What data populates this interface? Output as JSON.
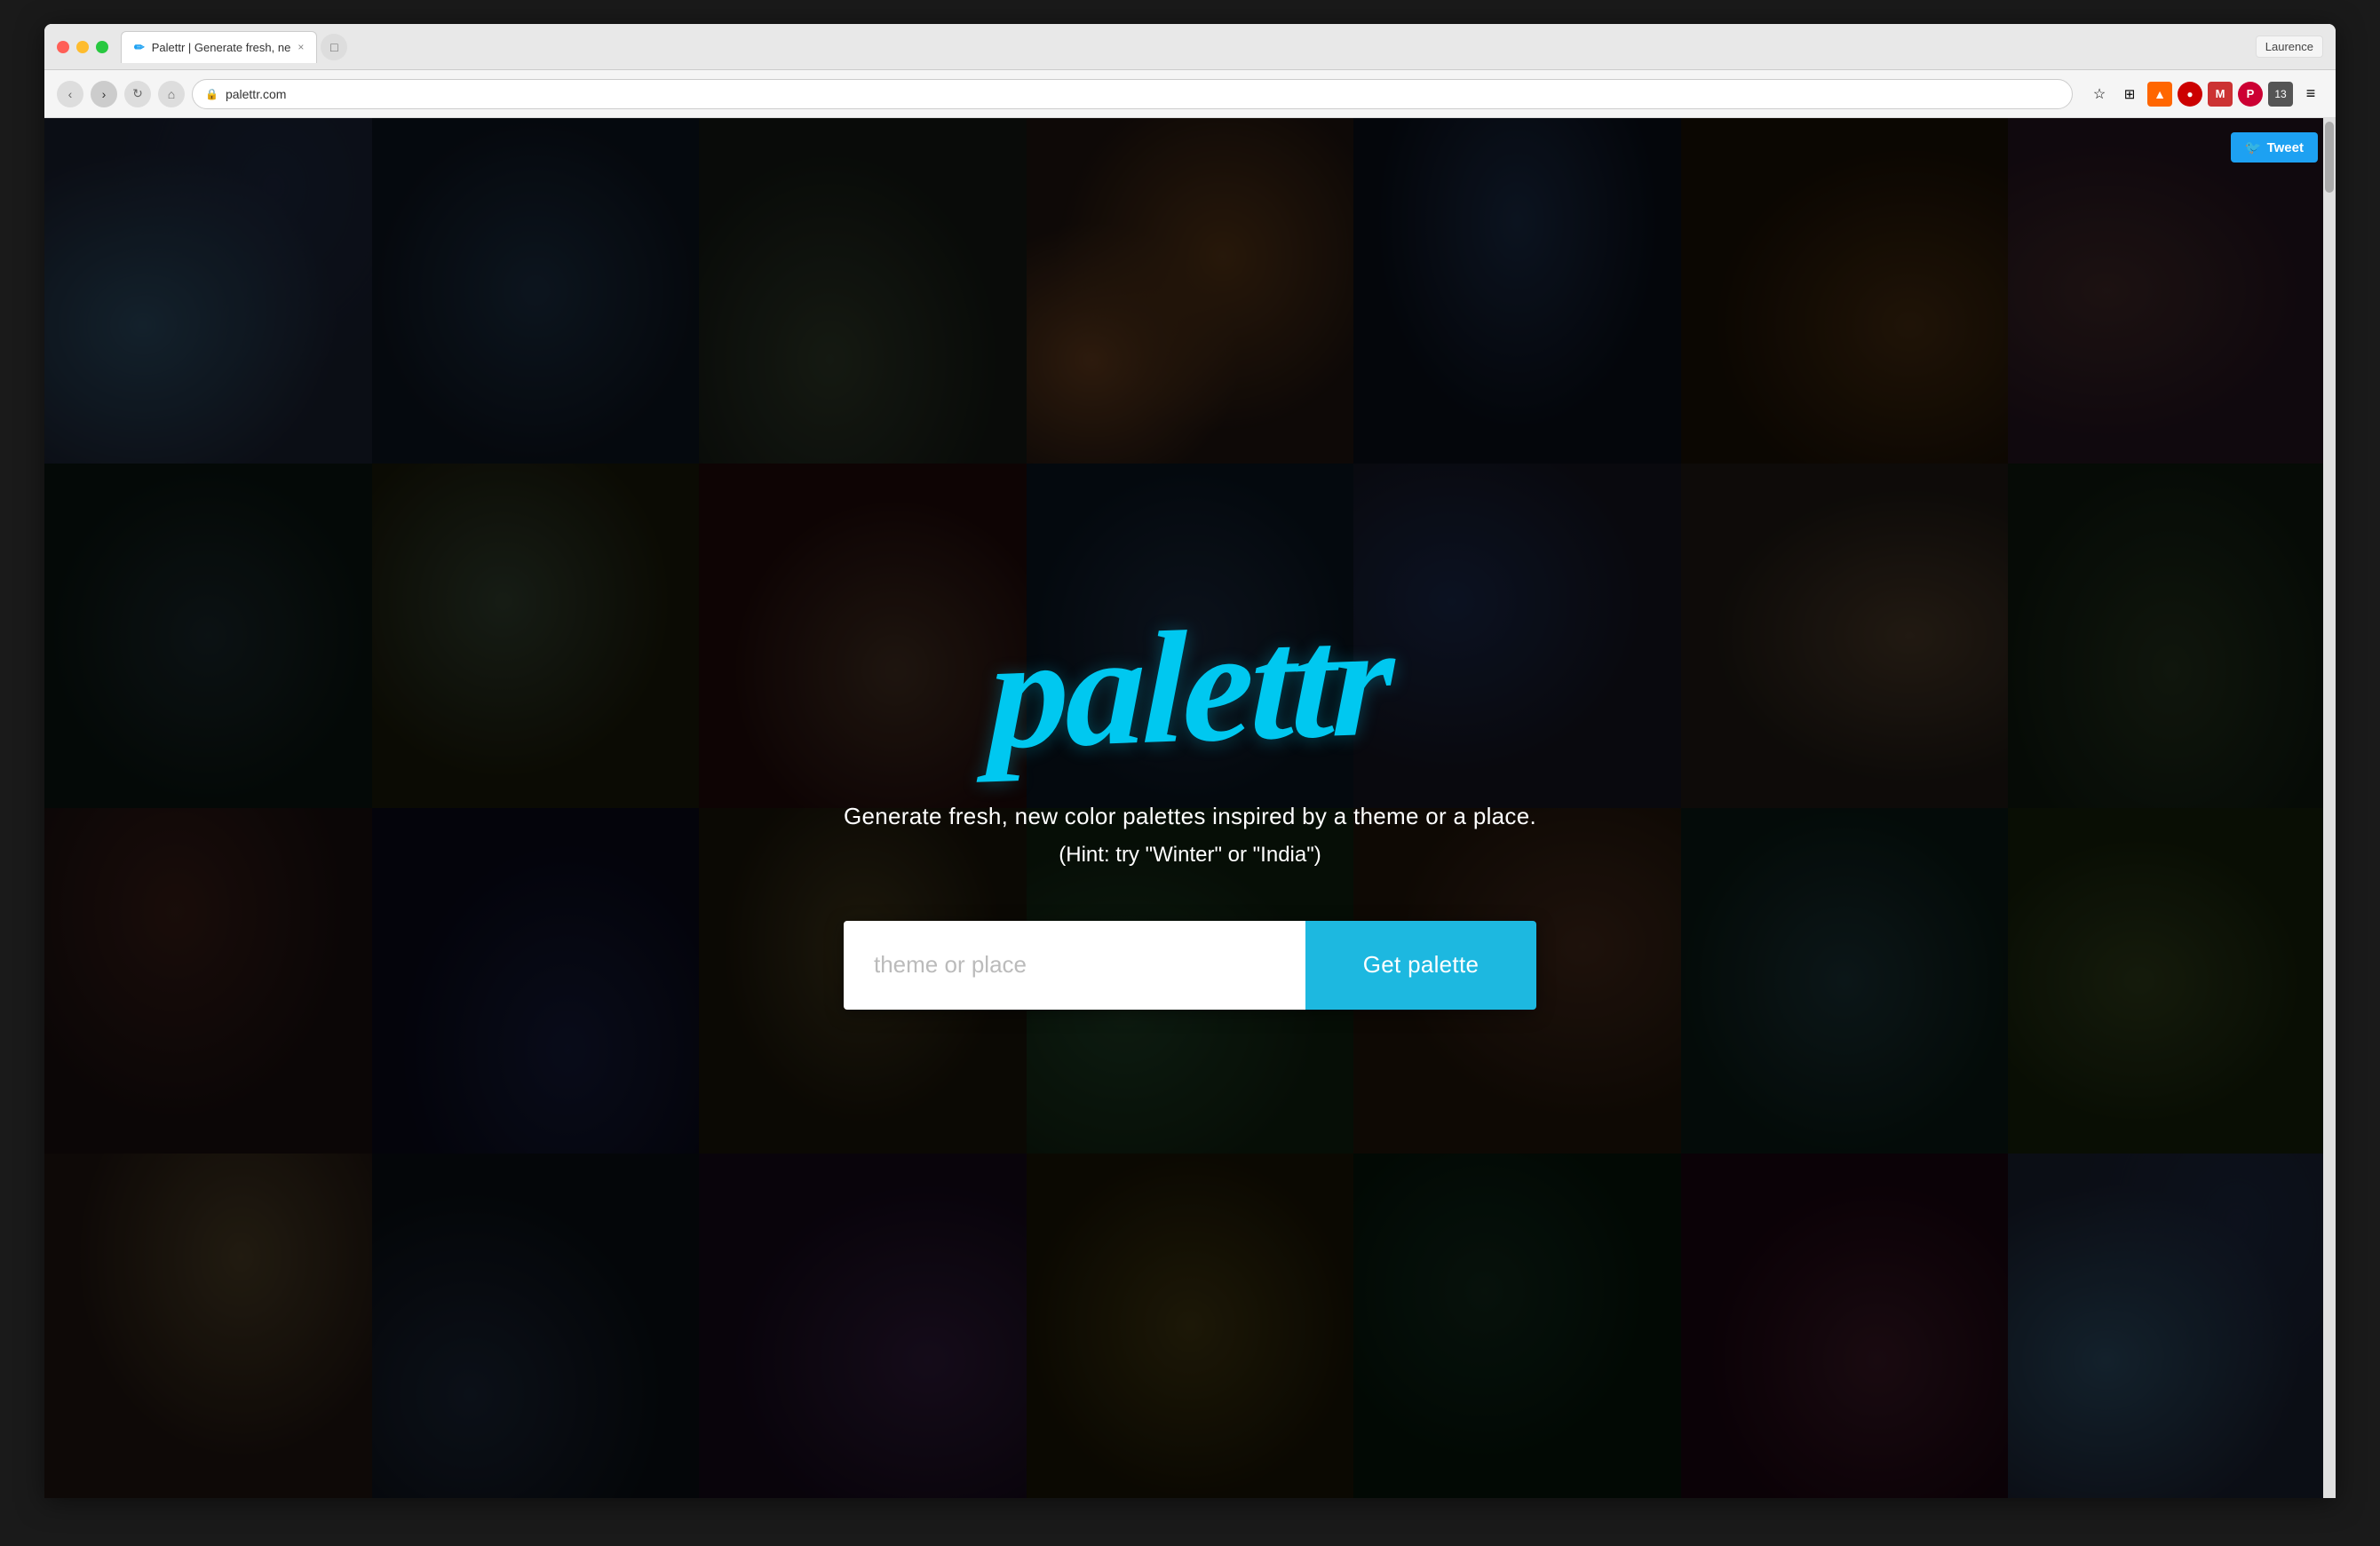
{
  "browser": {
    "url": "palettr.com",
    "tab_label": "Palettr | Generate fresh, ne",
    "user_name": "Laurence",
    "tab_close_symbol": "×",
    "tab_new_symbol": "□"
  },
  "nav": {
    "back_label": "‹",
    "forward_label": "›",
    "refresh_label": "↻",
    "home_label": "⌂",
    "lock_label": "🔒",
    "star_label": "☆"
  },
  "tweet_button": {
    "label": "Tweet",
    "bird": "🐦"
  },
  "hero": {
    "logo": "palettr",
    "tagline": "Generate fresh, new color palettes inspired by a theme or a place.",
    "hint": "(Hint: try \"Winter\" or \"India\")",
    "input_placeholder": "theme or place",
    "button_label": "Get palette"
  },
  "colors": {
    "brand_cyan": "#00c8f0",
    "button_cyan": "#1db8e0",
    "tweet_blue": "#1da1f2",
    "background_dark": "#1a1a1a",
    "browser_bg": "#f0f0f0"
  }
}
